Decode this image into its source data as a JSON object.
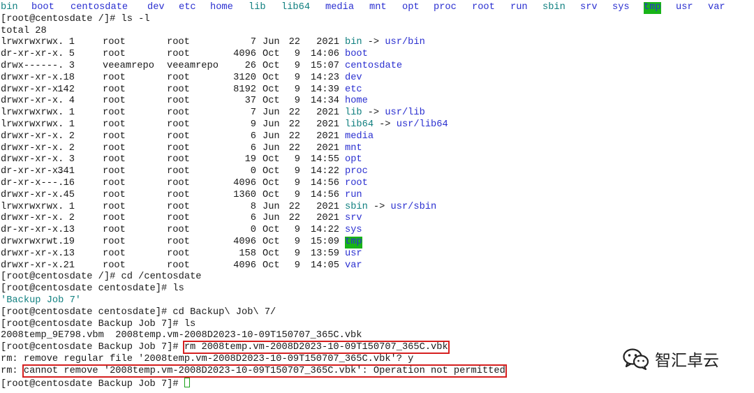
{
  "terminal": {
    "top_listing": [
      {
        "text": "bin",
        "kind": "link"
      },
      {
        "text": "boot",
        "kind": "dir"
      },
      {
        "text": "centosdate",
        "kind": "dir"
      },
      {
        "text": "dev",
        "kind": "dir"
      },
      {
        "text": "etc",
        "kind": "dir"
      },
      {
        "text": "home",
        "kind": "dir"
      },
      {
        "text": "lib",
        "kind": "link"
      },
      {
        "text": "lib64",
        "kind": "link"
      },
      {
        "text": "media",
        "kind": "dir"
      },
      {
        "text": "mnt",
        "kind": "dir"
      },
      {
        "text": "opt",
        "kind": "dir"
      },
      {
        "text": "proc",
        "kind": "dir"
      },
      {
        "text": "root",
        "kind": "dir"
      },
      {
        "text": "run",
        "kind": "dir"
      },
      {
        "text": "sbin",
        "kind": "link"
      },
      {
        "text": "srv",
        "kind": "dir"
      },
      {
        "text": "sys",
        "kind": "dir"
      },
      {
        "text": "tmp",
        "kind": "sticky"
      },
      {
        "text": "usr",
        "kind": "dir"
      },
      {
        "text": "var",
        "kind": "dir"
      }
    ],
    "prompt_root": "[root@centosdate /]# ",
    "prompt_centosdate": "[root@centosdate centosdate]# ",
    "prompt_backup": "[root@centosdate Backup Job 7]# ",
    "cmd_ls_l": "ls -l",
    "total": "total 28",
    "long_listing": [
      {
        "perms": "lrwxrwxrwx.",
        "links": "1",
        "owner": "root",
        "group": "root",
        "size": "7",
        "month": "Jun",
        "day": "22",
        "time": "2021",
        "name": "bin",
        "kind": "link",
        "target": "usr/bin"
      },
      {
        "perms": "dr-xr-xr-x.",
        "links": "5",
        "owner": "root",
        "group": "root",
        "size": "4096",
        "month": "Oct",
        "day": "9",
        "time": "14:06",
        "name": "boot",
        "kind": "dir",
        "target": ""
      },
      {
        "perms": "drwx------.",
        "links": "3",
        "owner": "veeamrepo",
        "group": "veeamrepo",
        "size": "26",
        "month": "Oct",
        "day": "9",
        "time": "15:07",
        "name": "centosdate",
        "kind": "dir",
        "target": ""
      },
      {
        "perms": "drwxr-xr-x.",
        "links": "18",
        "owner": "root",
        "group": "root",
        "size": "3120",
        "month": "Oct",
        "day": "9",
        "time": "14:23",
        "name": "dev",
        "kind": "dir",
        "target": ""
      },
      {
        "perms": "drwxr-xr-x.",
        "links": "142",
        "owner": "root",
        "group": "root",
        "size": "8192",
        "month": "Oct",
        "day": "9",
        "time": "14:39",
        "name": "etc",
        "kind": "dir",
        "target": ""
      },
      {
        "perms": "drwxr-xr-x.",
        "links": "4",
        "owner": "root",
        "group": "root",
        "size": "37",
        "month": "Oct",
        "day": "9",
        "time": "14:34",
        "name": "home",
        "kind": "dir",
        "target": ""
      },
      {
        "perms": "lrwxrwxrwx.",
        "links": "1",
        "owner": "root",
        "group": "root",
        "size": "7",
        "month": "Jun",
        "day": "22",
        "time": "2021",
        "name": "lib",
        "kind": "link",
        "target": "usr/lib"
      },
      {
        "perms": "lrwxrwxrwx.",
        "links": "1",
        "owner": "root",
        "group": "root",
        "size": "9",
        "month": "Jun",
        "day": "22",
        "time": "2021",
        "name": "lib64",
        "kind": "link",
        "target": "usr/lib64"
      },
      {
        "perms": "drwxr-xr-x.",
        "links": "2",
        "owner": "root",
        "group": "root",
        "size": "6",
        "month": "Jun",
        "day": "22",
        "time": "2021",
        "name": "media",
        "kind": "dir",
        "target": ""
      },
      {
        "perms": "drwxr-xr-x.",
        "links": "2",
        "owner": "root",
        "group": "root",
        "size": "6",
        "month": "Jun",
        "day": "22",
        "time": "2021",
        "name": "mnt",
        "kind": "dir",
        "target": ""
      },
      {
        "perms": "drwxr-xr-x.",
        "links": "3",
        "owner": "root",
        "group": "root",
        "size": "19",
        "month": "Oct",
        "day": "9",
        "time": "14:55",
        "name": "opt",
        "kind": "dir",
        "target": ""
      },
      {
        "perms": "dr-xr-xr-x.",
        "links": "341",
        "owner": "root",
        "group": "root",
        "size": "0",
        "month": "Oct",
        "day": "9",
        "time": "14:22",
        "name": "proc",
        "kind": "dir",
        "target": ""
      },
      {
        "perms": "dr-xr-x---.",
        "links": "16",
        "owner": "root",
        "group": "root",
        "size": "4096",
        "month": "Oct",
        "day": "9",
        "time": "14:56",
        "name": "root",
        "kind": "dir",
        "target": ""
      },
      {
        "perms": "drwxr-xr-x.",
        "links": "45",
        "owner": "root",
        "group": "root",
        "size": "1360",
        "month": "Oct",
        "day": "9",
        "time": "14:56",
        "name": "run",
        "kind": "dir",
        "target": ""
      },
      {
        "perms": "lrwxrwxrwx.",
        "links": "1",
        "owner": "root",
        "group": "root",
        "size": "8",
        "month": "Jun",
        "day": "22",
        "time": "2021",
        "name": "sbin",
        "kind": "link",
        "target": "usr/sbin"
      },
      {
        "perms": "drwxr-xr-x.",
        "links": "2",
        "owner": "root",
        "group": "root",
        "size": "6",
        "month": "Jun",
        "day": "22",
        "time": "2021",
        "name": "srv",
        "kind": "dir",
        "target": ""
      },
      {
        "perms": "dr-xr-xr-x.",
        "links": "13",
        "owner": "root",
        "group": "root",
        "size": "0",
        "month": "Oct",
        "day": "9",
        "time": "14:22",
        "name": "sys",
        "kind": "dir",
        "target": ""
      },
      {
        "perms": "drwxrwxrwt.",
        "links": "19",
        "owner": "root",
        "group": "root",
        "size": "4096",
        "month": "Oct",
        "day": "9",
        "time": "15:09",
        "name": "tmp",
        "kind": "sticky",
        "target": ""
      },
      {
        "perms": "drwxr-xr-x.",
        "links": "13",
        "owner": "root",
        "group": "root",
        "size": "158",
        "month": "Oct",
        "day": "9",
        "time": "13:59",
        "name": "usr",
        "kind": "dir",
        "target": ""
      },
      {
        "perms": "drwxr-xr-x.",
        "links": "21",
        "owner": "root",
        "group": "root",
        "size": "4096",
        "month": "Oct",
        "day": "9",
        "time": "14:05",
        "name": "var",
        "kind": "dir",
        "target": ""
      }
    ],
    "cmd_cd_centosdate": "cd /centosdate",
    "cmd_ls": "ls",
    "ls_result_backup": "'Backup Job 7'",
    "cmd_cd_backup": "cd Backup\\ Job\\ 7/",
    "ls_files": "2008temp_9E798.vbm  2008temp.vm-2008D2023-10-09T150707_365C.vbk",
    "cmd_rm": "rm 2008temp.vm-2008D2023-10-09T150707_365C.vbk",
    "rm_prompt": "rm: remove regular file '2008temp.vm-2008D2023-10-09T150707_365C.vbk'? y",
    "rm_error_prefix": "rm: ",
    "rm_error": "cannot remove '2008temp.vm-2008D2023-10-09T150707_365C.vbk': Operation not permitted"
  },
  "watermark": {
    "text": "智汇卓云",
    "icon": "wechat-icon"
  },
  "colors": {
    "dir": "#2a2fd0",
    "link": "#0f7f7f",
    "sticky_bg": "#18b418",
    "highlight_box": "#d61f1f"
  }
}
